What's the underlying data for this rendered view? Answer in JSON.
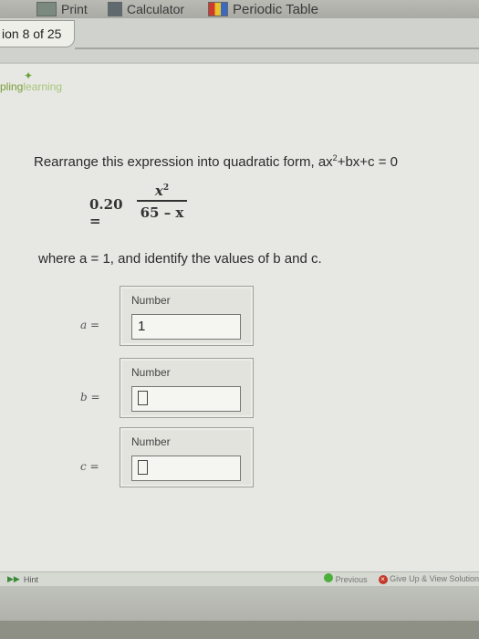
{
  "toolbar": {
    "print_label": "Print",
    "calculator_label": "Calculator",
    "periodic_label": "Periodic Table"
  },
  "question_tab": {
    "label": "ion 8 of 25"
  },
  "logo": {
    "word1": "pling",
    "word2": "learning"
  },
  "question": {
    "prompt_prefix": "Rearrange this expression into quadratic form, ax",
    "prompt_sup": "2",
    "prompt_suffix": "+bx+c = 0",
    "lhs": "0.20 =",
    "numerator": "x",
    "numerator_sup": "2",
    "denominator": "65 – x",
    "instruction": "where a = 1, and identify the values of b and c."
  },
  "fields": [
    {
      "var": "a =",
      "label": "Number",
      "value": "1"
    },
    {
      "var": "b =",
      "label": "Number",
      "value": ""
    },
    {
      "var": "c =",
      "label": "Number",
      "value": ""
    }
  ],
  "bottom": {
    "hint": "Hint",
    "previous": "Previous",
    "give_up": "Give Up & View Solution"
  }
}
